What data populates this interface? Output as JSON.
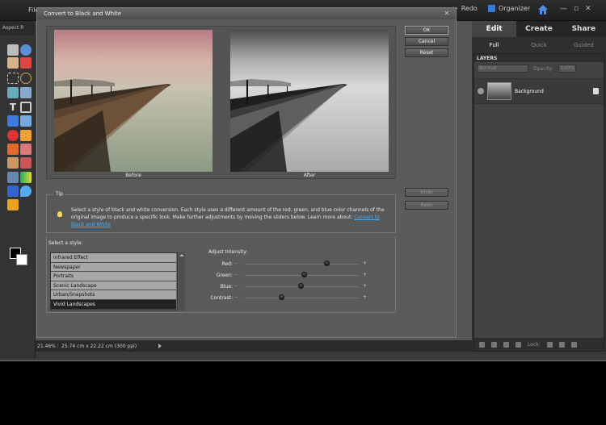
{
  "menubar": {
    "file": "File",
    "redo": "Redo",
    "organizer": "Organizer"
  },
  "options_bar": {
    "aspect_label": "Aspect R"
  },
  "status": {
    "zoom": "21.46%",
    "dims": "25.74 cm x 22.22 cm (300 ppi)"
  },
  "right_panel": {
    "tabs": [
      "Edit",
      "Create",
      "Share"
    ],
    "subtabs": [
      "Full",
      "Quick",
      "Guided"
    ],
    "layers_title": "LAYERS",
    "blend_mode": "Normal",
    "opacity_label": "Opacity:",
    "opacity_value": "100%",
    "layer_name": "Background",
    "lock_label": "Lock:"
  },
  "dialog": {
    "title": "Convert to Black and White",
    "before_label": "Before",
    "after_label": "After",
    "ok": "OK",
    "cancel": "Cancel",
    "reset": "Reset",
    "undo": "Undo",
    "redo": "Redo",
    "tip_label": "Tip",
    "tip_text": "Select a style of black and white conversion. Each style uses a different amount of the red, green, and blue color channels of the original image to produce a specific look. Make further adjustments by moving the sliders below. Learn more about:",
    "tip_link": "Convert to Black and White",
    "select_style_label": "Select a style:",
    "styles": [
      "Infrared Effect",
      "Newspaper",
      "Portraits",
      "Scenic Landscape",
      "Urban/Snapshots",
      "Vivid Landscapes"
    ],
    "selected_style": "Vivid Landscapes",
    "adjust_label": "Adjust Intensity:",
    "sliders": [
      {
        "label": "Red:",
        "value": 0.73
      },
      {
        "label": "Green:",
        "value": 0.53
      },
      {
        "label": "Blue:",
        "value": 0.5
      },
      {
        "label": "Contrast:",
        "value": 0.33
      }
    ]
  }
}
